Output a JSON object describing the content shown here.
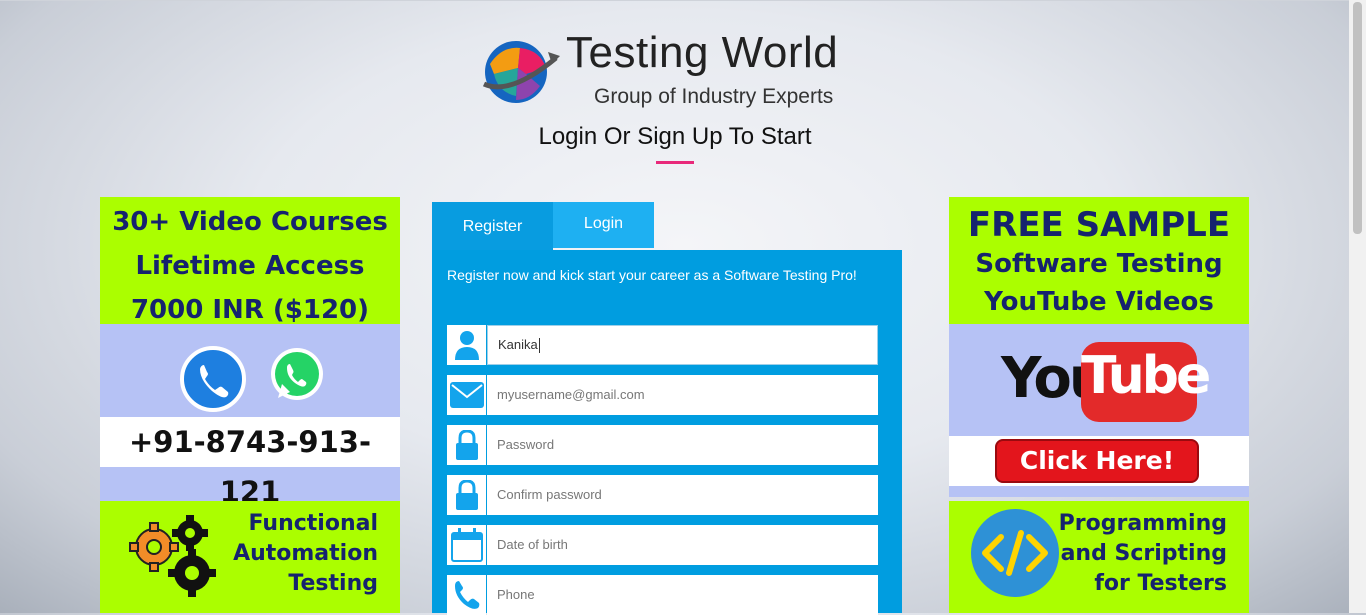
{
  "header": {
    "brand": "Testing World",
    "tagline": "Group of Industry Experts",
    "headline": "Login Or Sign Up To Start"
  },
  "left_ads": {
    "courses_line1": "30+ Video Courses",
    "courses_line2": "Lifetime Access",
    "courses_line3": "7000 INR ($120)",
    "phone": "+91-8743-913-121",
    "functional_line1": "Functional",
    "functional_line2": "Automation",
    "functional_line3": "Testing"
  },
  "right_ads": {
    "free_line1": "FREE SAMPLE",
    "free_line2": "Software Testing",
    "free_line3": "YouTube Videos",
    "yt_you": "You",
    "yt_tube": "Tube",
    "click_label": "Click Here!",
    "prog_line1": "Programming",
    "prog_line2": "and Scripting",
    "prog_line3": "for Testers"
  },
  "form": {
    "tabs": [
      {
        "label": "Register",
        "active": true
      },
      {
        "label": "Login",
        "active": false
      }
    ],
    "intro": "Register now and kick start your career as a Software Testing Pro!",
    "fields": [
      {
        "icon": "user-icon",
        "value": "Kanika",
        "placeholder": ""
      },
      {
        "icon": "envelope-icon",
        "value": "",
        "placeholder": "myusername@gmail.com"
      },
      {
        "icon": "lock-icon",
        "value": "",
        "placeholder": "Password"
      },
      {
        "icon": "lock-icon",
        "value": "",
        "placeholder": "Confirm password"
      },
      {
        "icon": "calendar-icon",
        "value": "",
        "placeholder": "Date of birth"
      },
      {
        "icon": "phone-icon",
        "value": "",
        "placeholder": "Phone"
      }
    ]
  },
  "colors": {
    "panel": "#009de0",
    "tab_inactive": "#1eb0f2",
    "icon": "#13a4ec",
    "lime": "#abfe00",
    "lavender": "#b6c2f5",
    "accent_underline": "#e8297a",
    "ad_text": "#16236e"
  }
}
